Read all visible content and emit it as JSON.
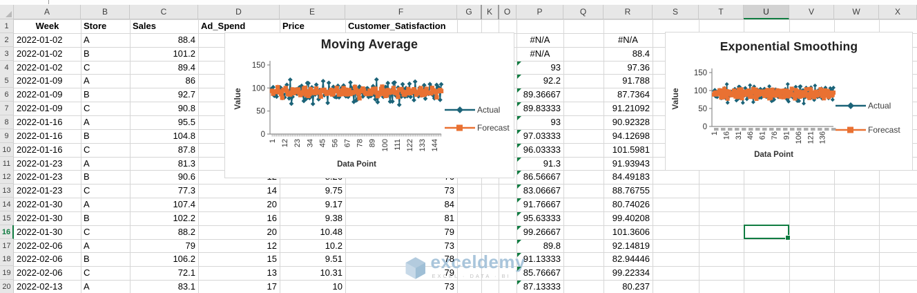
{
  "sheet": {
    "col_headers": [
      "A",
      "B",
      "C",
      "D",
      "E",
      "F",
      "G",
      "K",
      "O",
      "P",
      "Q",
      "R",
      "S",
      "T",
      "U",
      "V",
      "W",
      "X"
    ],
    "hidden_after": [
      "G",
      "K"
    ],
    "row_numbers": [
      1,
      2,
      3,
      4,
      5,
      6,
      7,
      8,
      9,
      10,
      11,
      12,
      13,
      14,
      15,
      16,
      17,
      18,
      19,
      20
    ],
    "selected_col": "U",
    "selected_row": 16,
    "selected_cell": "U16",
    "rows": [
      {
        "n": 1,
        "bold": true,
        "cells": {
          "A": "Week",
          "B": "Store",
          "C": "Sales",
          "D": "Ad_Spend",
          "E": "Price",
          "F": "Customer_Satisfaction"
        }
      },
      {
        "n": 2,
        "cells": {
          "A": "2022-01-02",
          "B": "A",
          "C": "88.4",
          "P": "#N/A",
          "R": "#N/A"
        }
      },
      {
        "n": 3,
        "cells": {
          "A": "2022-01-02",
          "B": "B",
          "C": "101.2",
          "P": "#N/A",
          "R": "88.4"
        }
      },
      {
        "n": 4,
        "cells": {
          "A": "2022-01-02",
          "B": "C",
          "C": "89.4",
          "P": "93",
          "R": "97.36"
        }
      },
      {
        "n": 5,
        "cells": {
          "A": "2022-01-09",
          "B": "A",
          "C": "86",
          "P": "92.2",
          "R": "91.788"
        }
      },
      {
        "n": 6,
        "cells": {
          "A": "2022-01-09",
          "B": "B",
          "C": "92.7",
          "P": "89.36667",
          "R": "87.7364"
        }
      },
      {
        "n": 7,
        "cells": {
          "A": "2022-01-09",
          "B": "C",
          "C": "90.8",
          "P": "89.83333",
          "R": "91.21092"
        }
      },
      {
        "n": 8,
        "cells": {
          "A": "2022-01-16",
          "B": "A",
          "C": "95.5",
          "P": "93",
          "R": "90.92328"
        }
      },
      {
        "n": 9,
        "cells": {
          "A": "2022-01-16",
          "B": "B",
          "C": "104.8",
          "P": "97.03333",
          "R": "94.12698"
        }
      },
      {
        "n": 10,
        "cells": {
          "A": "2022-01-16",
          "B": "C",
          "C": "87.8",
          "P": "96.03333",
          "R": "101.5981"
        }
      },
      {
        "n": 11,
        "cells": {
          "A": "2022-01-23",
          "B": "A",
          "C": "81.3",
          "P": "91.3",
          "R": "91.93943"
        }
      },
      {
        "n": 12,
        "cells": {
          "A": "2022-01-23",
          "B": "B",
          "C": "90.6",
          "D": "12",
          "E": "8.26",
          "F": "76",
          "P": "86.56667",
          "R": "84.49183"
        }
      },
      {
        "n": 13,
        "cells": {
          "A": "2022-01-23",
          "B": "C",
          "C": "77.3",
          "D": "14",
          "E": "9.75",
          "F": "73",
          "P": "83.06667",
          "R": "88.76755"
        }
      },
      {
        "n": 14,
        "cells": {
          "A": "2022-01-30",
          "B": "A",
          "C": "107.4",
          "D": "20",
          "E": "9.17",
          "F": "84",
          "P": "91.76667",
          "R": "80.74026"
        }
      },
      {
        "n": 15,
        "cells": {
          "A": "2022-01-30",
          "B": "B",
          "C": "102.2",
          "D": "16",
          "E": "9.38",
          "F": "81",
          "P": "95.63333",
          "R": "99.40208"
        }
      },
      {
        "n": 16,
        "cells": {
          "A": "2022-01-30",
          "B": "C",
          "C": "88.2",
          "D": "20",
          "E": "10.48",
          "F": "79",
          "P": "99.26667",
          "R": "101.3606"
        }
      },
      {
        "n": 17,
        "cells": {
          "A": "2022-02-06",
          "B": "A",
          "C": "79",
          "D": "12",
          "E": "10.2",
          "F": "73",
          "P": "89.8",
          "R": "92.14819"
        }
      },
      {
        "n": 18,
        "cells": {
          "A": "2022-02-06",
          "B": "B",
          "C": "106.2",
          "D": "15",
          "E": "9.51",
          "F": "78",
          "P": "91.13333",
          "R": "82.94446"
        }
      },
      {
        "n": 19,
        "cells": {
          "A": "2022-02-06",
          "B": "C",
          "C": "72.1",
          "D": "13",
          "E": "10.31",
          "F": "79",
          "P": "85.76667",
          "R": "99.22334"
        }
      },
      {
        "n": 20,
        "cells": {
          "A": "2022-02-13",
          "B": "A",
          "C": "83.1",
          "D": "17",
          "E": "10",
          "F": "73",
          "P": "87.13333",
          "R": "80.237"
        }
      }
    ]
  },
  "charts": [
    {
      "name": "moving-average",
      "chart_data": {
        "type": "line",
        "title": "Moving Average",
        "xlabel": "Data Point",
        "ylabel": "Value",
        "ylim": [
          0,
          150
        ],
        "y_ticks": [
          0,
          50,
          100,
          150
        ],
        "x_ticks": [
          1,
          12,
          23,
          34,
          45,
          56,
          67,
          78,
          89,
          100,
          111,
          122,
          133,
          144
        ],
        "n_points": 150,
        "grid": false,
        "legend_position": "right",
        "series": [
          {
            "name": "Actual",
            "color": "#1B6378",
            "marker": "diamond",
            "values_sample": [
              88.4,
              101.2,
              89.4,
              86,
              92.7,
              90.8,
              95.5,
              104.8,
              87.8,
              81.3,
              90.6,
              77.3,
              107.4,
              102.2,
              88.2,
              79,
              106.2,
              72.1,
              83.1
            ]
          },
          {
            "name": "Forecast",
            "color": "#E97132",
            "marker": "square",
            "values_sample": [
              93,
              92.2,
              89.36667,
              89.83333,
              93,
              97.03333,
              96.03333,
              91.3,
              86.56667,
              83.06667,
              91.76667,
              95.63333,
              99.26667,
              89.8,
              91.13333,
              85.76667,
              87.13333
            ]
          }
        ]
      }
    },
    {
      "name": "exponential-smoothing",
      "chart_data": {
        "type": "line",
        "title": "Exponential Smoothing",
        "xlabel": "Data Point",
        "ylabel": "Value",
        "ylim": [
          0,
          150
        ],
        "y_ticks": [
          0,
          50,
          100,
          150
        ],
        "x_ticks": [
          1,
          16,
          31,
          46,
          61,
          76,
          91,
          106,
          121,
          136
        ],
        "n_points": 150,
        "grid": false,
        "legend_position": "right",
        "series": [
          {
            "name": "Actual",
            "color": "#1B6378",
            "marker": "diamond",
            "values_sample": [
              88.4,
              101.2,
              89.4,
              86,
              92.7,
              90.8,
              95.5,
              104.8,
              87.8,
              81.3,
              90.6,
              77.3,
              107.4,
              102.2,
              88.2,
              79,
              106.2,
              72.1,
              83.1
            ]
          },
          {
            "name": "Forecast",
            "color": "#E97132",
            "marker": "square",
            "values_sample": [
              88.4,
              97.36,
              91.788,
              87.7364,
              91.21092,
              90.92328,
              94.12698,
              101.5981,
              91.93943,
              84.49183,
              88.76755,
              80.74026,
              99.40208,
              101.3606,
              92.14819,
              82.94446,
              99.22334,
              80.237
            ]
          }
        ]
      }
    }
  ],
  "watermark": {
    "brand": "exceldemy",
    "tagline": "EXCEL · DATA · BI"
  },
  "colors": {
    "series_actual": "#1B6378",
    "series_forecast": "#E97132",
    "excel_green": "#107C41",
    "error_flag_green": "#107C41"
  }
}
